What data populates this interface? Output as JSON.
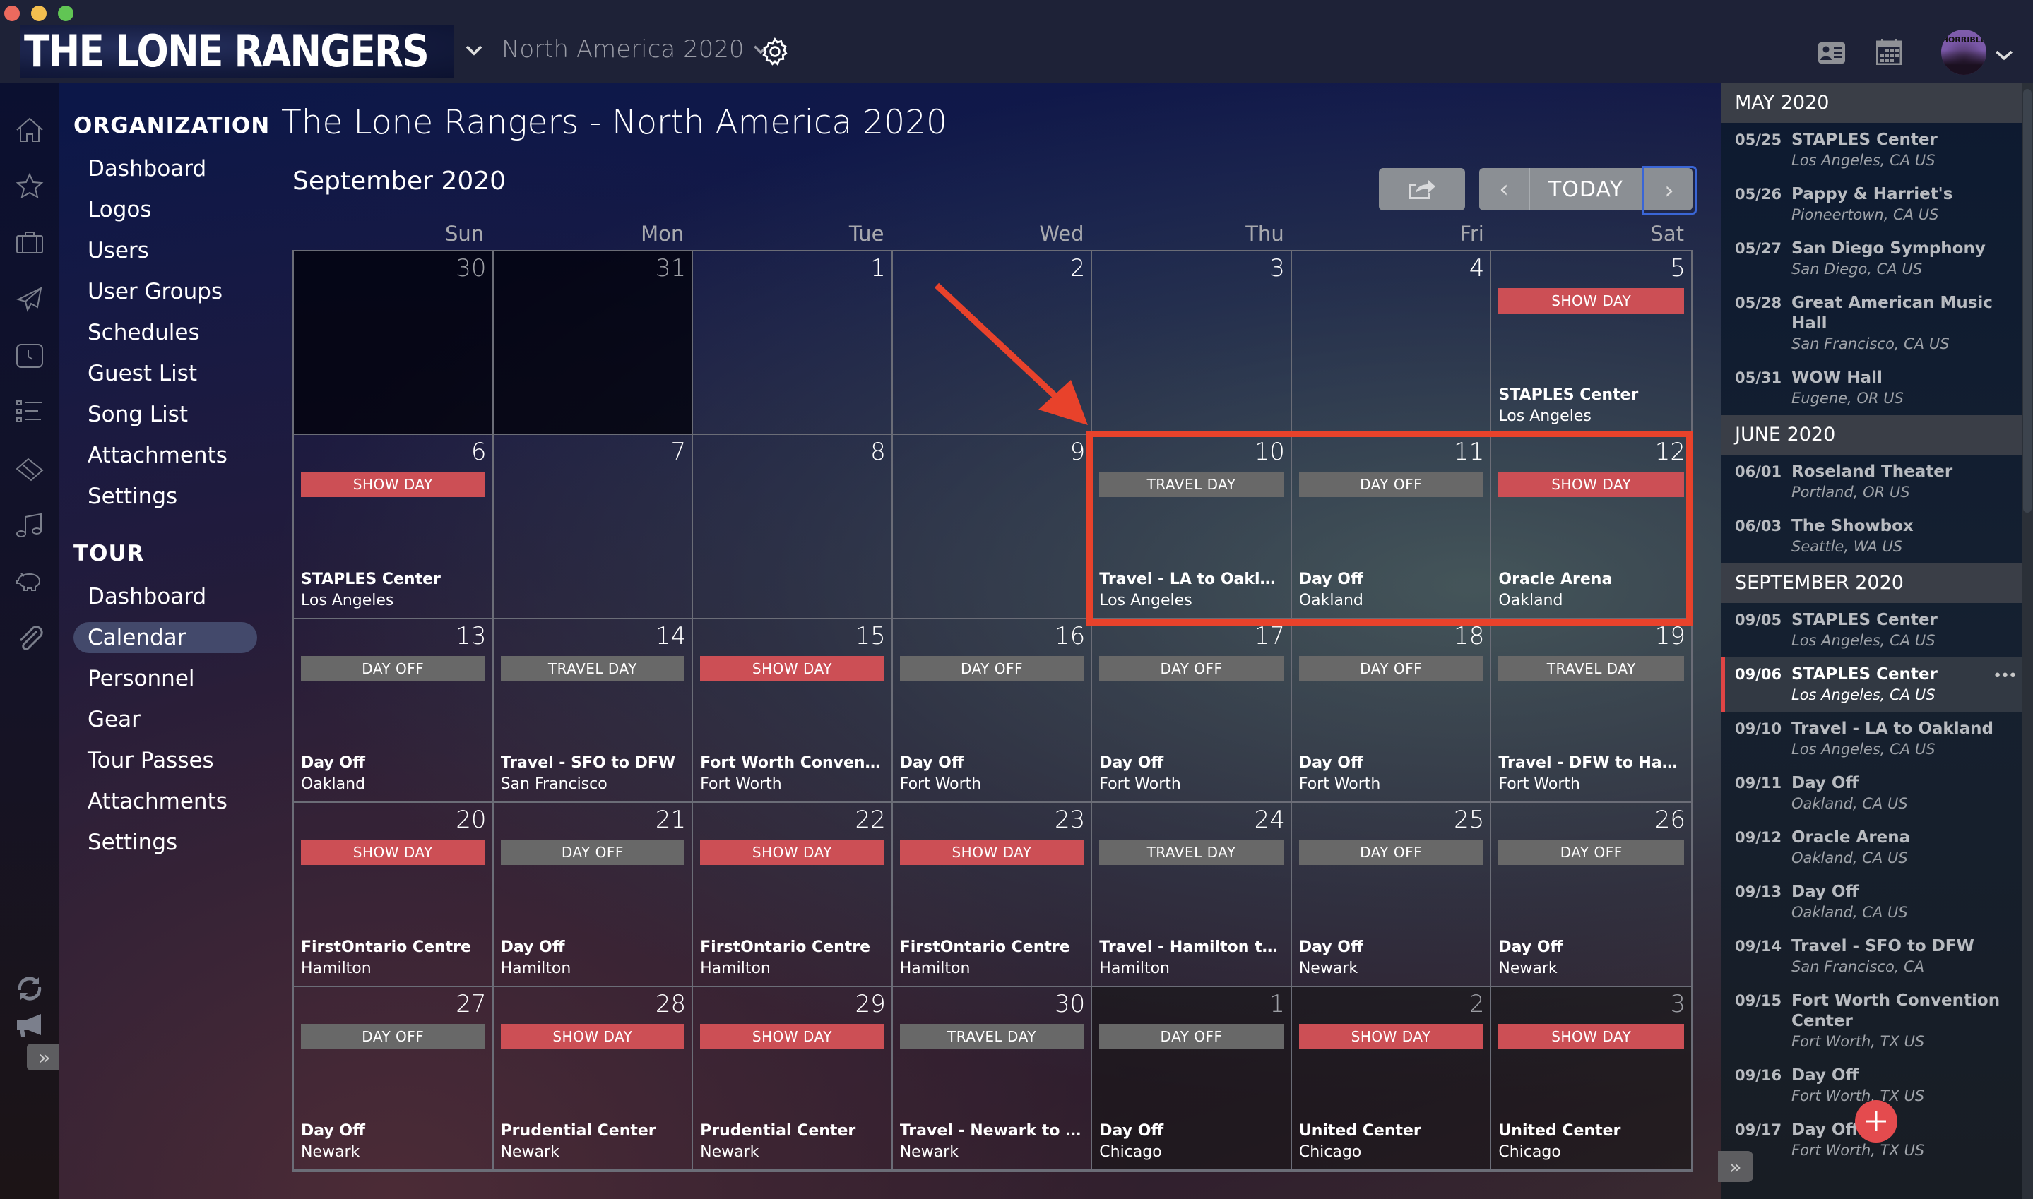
{
  "window": {
    "controls": [
      "close",
      "minimize",
      "maximize"
    ]
  },
  "header": {
    "band_logo_text": "THE LONE RANGERS",
    "tour_selector": "North America 2020",
    "icons": [
      "chevron-down-icon",
      "settings-gear-icon",
      "contact-card-icon",
      "calendar-icon",
      "avatar",
      "chevron-down-icon"
    ],
    "avatar_text": "HORRIBLE"
  },
  "rail_icons": [
    "home-icon",
    "star-icon",
    "briefcase-icon",
    "airplane-icon",
    "clock-icon",
    "checklist-icon",
    "ticket-icon",
    "music-note-icon",
    "piggy-bank-icon",
    "paperclip-icon",
    "sync-icon",
    "megaphone-icon"
  ],
  "rail_expand_label": "»",
  "nav": {
    "organization": {
      "heading": "ORGANIZATION",
      "items": [
        "Dashboard",
        "Logos",
        "Users",
        "User Groups",
        "Schedules",
        "Guest List",
        "Song List",
        "Attachments",
        "Settings"
      ]
    },
    "tour": {
      "heading": "TOUR",
      "items": [
        "Dashboard",
        "Calendar",
        "Personnel",
        "Gear",
        "Tour Passes",
        "Attachments",
        "Settings"
      ],
      "active": "Calendar"
    }
  },
  "page": {
    "title": "The Lone Rangers - North America 2020",
    "month": "September 2020",
    "toolbar": {
      "share_icon": "share-icon",
      "prev": "‹",
      "today": "TODAY",
      "next": "›"
    }
  },
  "calendar": {
    "days_of_week": [
      "Sun",
      "Mon",
      "Tue",
      "Wed",
      "Thu",
      "Fri",
      "Sat"
    ],
    "colors": {
      "show_day": "#cc4f55",
      "travel_day": "#686868",
      "day_off": "#686868",
      "highlight": "#e8422b"
    },
    "cells": [
      {
        "day": "30",
        "muted": true,
        "kind": "prev"
      },
      {
        "day": "31",
        "muted": true,
        "kind": "prev"
      },
      {
        "day": "1"
      },
      {
        "day": "2"
      },
      {
        "day": "3"
      },
      {
        "day": "4"
      },
      {
        "day": "5",
        "badge": "SHOW DAY",
        "type": "show",
        "title": "STAPLES Center",
        "city": "Los Angeles"
      },
      {
        "day": "6",
        "badge": "SHOW DAY",
        "type": "show",
        "title": "STAPLES Center",
        "city": "Los Angeles"
      },
      {
        "day": "7"
      },
      {
        "day": "8"
      },
      {
        "day": "9"
      },
      {
        "day": "10",
        "badge": "TRAVEL DAY",
        "type": "travel",
        "title": "Travel - LA to Oakland",
        "city": "Los Angeles"
      },
      {
        "day": "11",
        "badge": "DAY OFF",
        "type": "off",
        "title": "Day Off",
        "city": "Oakland"
      },
      {
        "day": "12",
        "badge": "SHOW DAY",
        "type": "show",
        "title": "Oracle Arena",
        "city": "Oakland"
      },
      {
        "day": "13",
        "badge": "DAY OFF",
        "type": "off",
        "title": "Day Off",
        "city": "Oakland"
      },
      {
        "day": "14",
        "badge": "TRAVEL DAY",
        "type": "travel",
        "title": "Travel - SFO to DFW",
        "city": "San Francisco"
      },
      {
        "day": "15",
        "badge": "SHOW DAY",
        "type": "show",
        "title": "Fort Worth Convention…",
        "city": "Fort Worth"
      },
      {
        "day": "16",
        "badge": "DAY OFF",
        "type": "off",
        "title": "Day Off",
        "city": "Fort Worth"
      },
      {
        "day": "17",
        "badge": "DAY OFF",
        "type": "off",
        "title": "Day Off",
        "city": "Fort Worth"
      },
      {
        "day": "18",
        "badge": "DAY OFF",
        "type": "off",
        "title": "Day Off",
        "city": "Fort Worth"
      },
      {
        "day": "19",
        "badge": "TRAVEL DAY",
        "type": "travel",
        "title": "Travel - DFW to Hamilt…",
        "city": "Fort Worth"
      },
      {
        "day": "20",
        "badge": "SHOW DAY",
        "type": "show",
        "title": "FirstOntario Centre",
        "city": "Hamilton"
      },
      {
        "day": "21",
        "badge": "DAY OFF",
        "type": "off",
        "title": "Day Off",
        "city": "Hamilton"
      },
      {
        "day": "22",
        "badge": "SHOW DAY",
        "type": "show",
        "title": "FirstOntario Centre",
        "city": "Hamilton"
      },
      {
        "day": "23",
        "badge": "SHOW DAY",
        "type": "show",
        "title": "FirstOntario Centre",
        "city": "Hamilton"
      },
      {
        "day": "24",
        "badge": "TRAVEL DAY",
        "type": "travel",
        "title": "Travel - Hamilton to Ne…",
        "city": "Hamilton"
      },
      {
        "day": "25",
        "badge": "DAY OFF",
        "type": "off",
        "title": "Day Off",
        "city": "Newark"
      },
      {
        "day": "26",
        "badge": "DAY OFF",
        "type": "off",
        "title": "Day Off",
        "city": "Newark"
      },
      {
        "day": "27",
        "badge": "DAY OFF",
        "type": "off",
        "title": "Day Off",
        "city": "Newark"
      },
      {
        "day": "28",
        "badge": "SHOW DAY",
        "type": "show",
        "title": "Prudential Center",
        "city": "Newark"
      },
      {
        "day": "29",
        "badge": "SHOW DAY",
        "type": "show",
        "title": "Prudential Center",
        "city": "Newark"
      },
      {
        "day": "30",
        "badge": "TRAVEL DAY",
        "type": "travel",
        "title": "Travel - Newark to Chic…",
        "city": "Newark"
      },
      {
        "day": "1",
        "muted": true,
        "kind": "next",
        "badge": "DAY OFF",
        "type": "off",
        "title": "Day Off",
        "city": "Chicago"
      },
      {
        "day": "2",
        "muted": true,
        "kind": "next",
        "badge": "SHOW DAY",
        "type": "show",
        "title": "United Center",
        "city": "Chicago"
      },
      {
        "day": "3",
        "muted": true,
        "kind": "next",
        "badge": "SHOW DAY",
        "type": "show",
        "title": "United Center",
        "city": "Chicago"
      }
    ]
  },
  "right_panel": {
    "groups": [
      {
        "month": "MAY 2020",
        "items": [
          {
            "date": "05/25",
            "name": "STAPLES Center",
            "location": "Los Angeles, CA US"
          },
          {
            "date": "05/26",
            "name": "Pappy & Harriet's",
            "location": "Pioneertown, CA US"
          },
          {
            "date": "05/27",
            "name": "San Diego Symphony",
            "location": "San Diego, CA US"
          },
          {
            "date": "05/28",
            "name": "Great American Music Hall",
            "location": "San Francisco, CA US"
          },
          {
            "date": "05/31",
            "name": "WOW Hall",
            "location": "Eugene, OR US"
          }
        ]
      },
      {
        "month": "JUNE 2020",
        "items": [
          {
            "date": "06/01",
            "name": "Roseland Theater",
            "location": "Portland, OR US"
          },
          {
            "date": "06/03",
            "name": "The Showbox",
            "location": "Seattle, WA US"
          }
        ]
      },
      {
        "month": "SEPTEMBER 2020",
        "items": [
          {
            "date": "09/05",
            "name": "STAPLES Center",
            "location": "Los Angeles, CA US"
          },
          {
            "date": "09/06",
            "name": "STAPLES Center",
            "location": "Los Angeles, CA US",
            "selected": true
          },
          {
            "date": "09/10",
            "name": "Travel - LA to Oakland",
            "location": "Los Angeles, CA US"
          },
          {
            "date": "09/11",
            "name": "Day Off",
            "location": "Oakland, CA US"
          },
          {
            "date": "09/12",
            "name": "Oracle Arena",
            "location": "Oakland, CA US"
          },
          {
            "date": "09/13",
            "name": "Day Off",
            "location": "Oakland, CA US"
          },
          {
            "date": "09/14",
            "name": "Travel - SFO to DFW",
            "location": "San Francisco, CA"
          },
          {
            "date": "09/15",
            "name": "Fort Worth Convention Center",
            "location": "Fort Worth, TX US"
          },
          {
            "date": "09/16",
            "name": "Day Off",
            "location": "Fort Worth, TX US"
          },
          {
            "date": "09/17",
            "name": "Day Off",
            "location": "Fort Worth, TX US"
          }
        ]
      }
    ],
    "more_label": "•••",
    "add_label": "+",
    "expand_label": "»"
  }
}
